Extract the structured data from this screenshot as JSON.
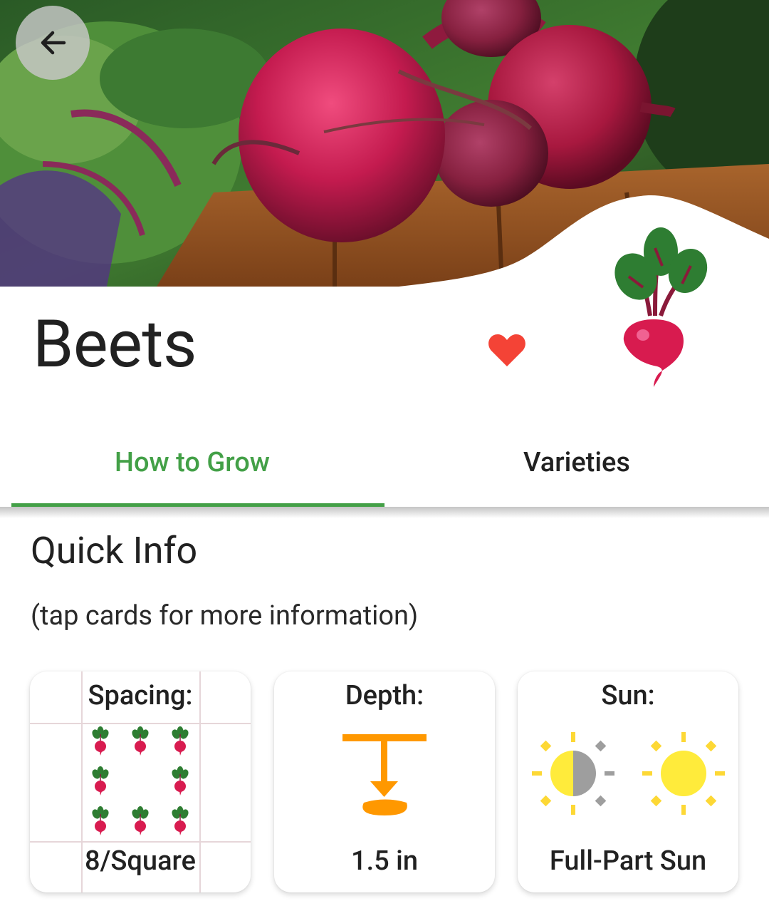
{
  "header": {
    "back_icon": "arrow-left-icon",
    "hero_image": "photo of fresh red beets on a wooden table",
    "title": "Beets",
    "favorite_icon": "heart-icon",
    "favorite_color": "#f44336",
    "plant_icon": "beet-icon"
  },
  "tabs": [
    {
      "label": "How to Grow",
      "selected": true
    },
    {
      "label": "Varieties",
      "selected": false
    }
  ],
  "accent_color": "#43a047",
  "quick_info": {
    "title": "Quick Info",
    "subtitle": "(tap cards for more information)",
    "cards": [
      {
        "label": "Spacing:",
        "value": "8/Square",
        "icon": "spacing-grid-icon"
      },
      {
        "label": "Depth:",
        "value": "1.5 in",
        "icon": "seed-depth-icon"
      },
      {
        "label": "Sun:",
        "value": "Full-Part Sun",
        "icon": "sun-icon"
      }
    ]
  }
}
